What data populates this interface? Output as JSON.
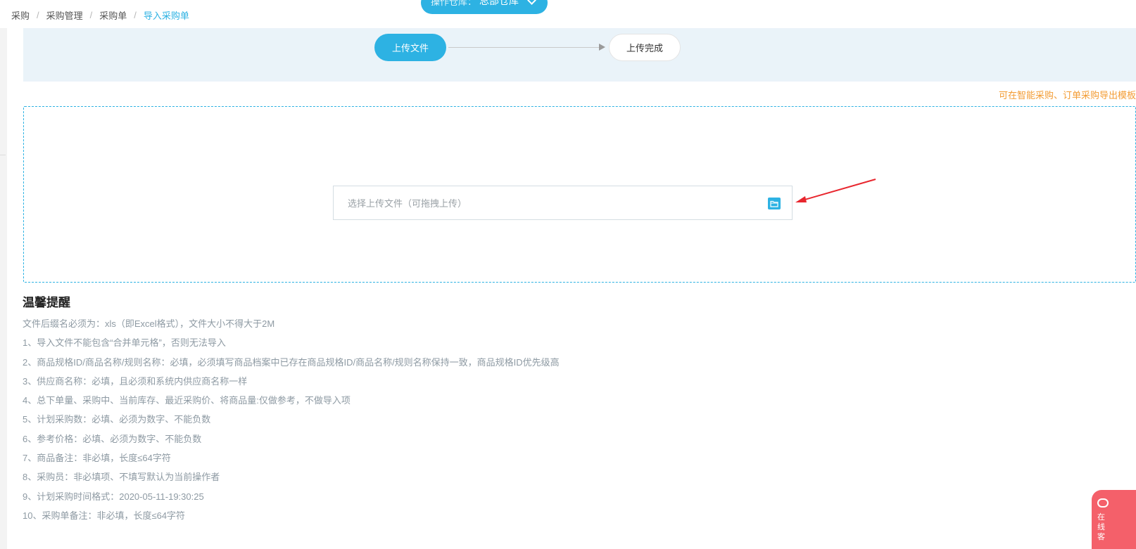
{
  "breadcrumb": {
    "items": [
      "采购",
      "采购管理",
      "采购单"
    ],
    "current": "导入采购单"
  },
  "warehouse": {
    "label": "操作仓库：",
    "value": "总部仓库"
  },
  "steps": {
    "step1": "上传文件",
    "step2": "上传完成"
  },
  "hint_link": "可在智能采购、订单采购导出模板",
  "upload": {
    "placeholder": "选择上传文件（可拖拽上传）"
  },
  "tips": {
    "title": "温馨提醒",
    "items": [
      "文件后缀名必须为：xls（即Excel格式），文件大小不得大于2M",
      "1、导入文件不能包含“合并单元格”，否则无法导入",
      "2、商品规格ID/商品名称/规则名称：必填，必须填写商品档案中已存在商品规格ID/商品名称/规则名称保持一致，商品规格ID优先级高",
      "3、供应商名称：必填，且必须和系统内供应商名称一样",
      "4、总下单量、采购中、当前库存、最近采购价、将商品量:仅做参考，不做导入项",
      "5、计划采购数：必填、必须为数字、不能负数",
      "6、参考价格：必填、必须为数字、不能负数",
      "7、商品备注：非必填，长度≤64字符",
      "8、采购员：非必填项、不填写默认为当前操作者",
      "9、计划采购时间格式：2020-05-11-19:30:25",
      "10、采购单备注：非必填，长度≤64字符"
    ]
  },
  "chat": {
    "chars": [
      "在",
      "线",
      "客"
    ]
  },
  "colors": {
    "accent": "#2db2e3",
    "orange": "#f39c34",
    "annotation": "#e8262e",
    "chat": "#f4606a"
  },
  "icons": {
    "folder": "folder-icon",
    "chevron": "chevron-down-icon",
    "chat": "chat-bubble-icon"
  }
}
